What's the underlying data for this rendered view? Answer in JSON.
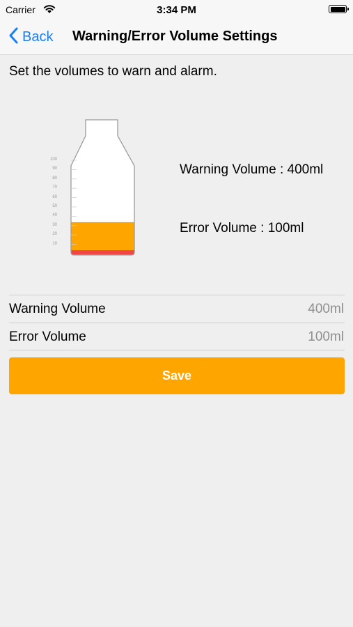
{
  "status_bar": {
    "carrier": "Carrier",
    "time": "3:34 PM"
  },
  "nav": {
    "back_label": "Back",
    "title": "Warning/Error Volume Settings"
  },
  "instruction": "Set the volumes to warn and alarm.",
  "bottle": {
    "scale_labels": [
      "100",
      "90",
      "80",
      "70",
      "60",
      "50",
      "40",
      "30",
      "20",
      "10"
    ],
    "warning_level_percent": 40,
    "error_level_percent": 10,
    "warning_color": "#ffa500",
    "error_color": "#f24646"
  },
  "info": {
    "warning_text": "Warning Volume : 400ml",
    "error_text": "Error Volume : 100ml"
  },
  "settings": [
    {
      "label": "Warning Volume",
      "value": "400ml"
    },
    {
      "label": "Error Volume",
      "value": "100ml"
    }
  ],
  "save_label": "Save",
  "colors": {
    "accent_blue": "#1a7ef5",
    "save_orange": "#ffa500",
    "background": "#efefef"
  }
}
